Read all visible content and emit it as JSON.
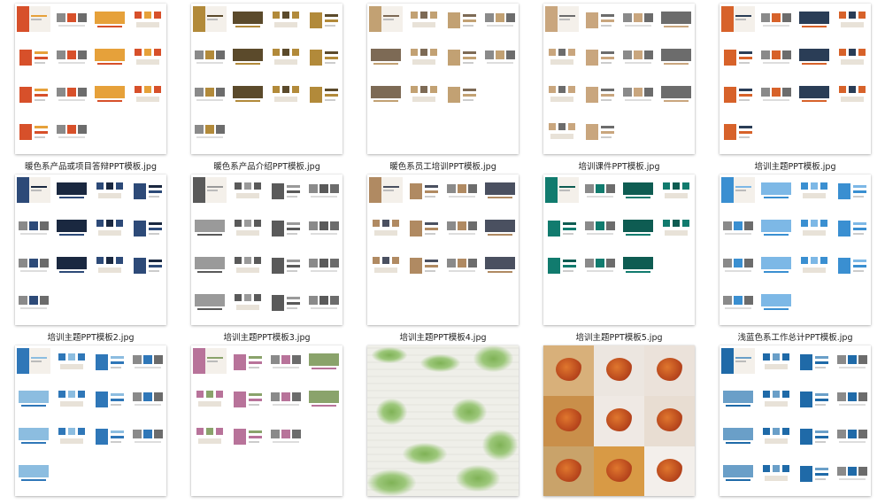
{
  "files": [
    {
      "name": "暖色系产品或项目答辩PPT模板.jpg",
      "theme": "warm",
      "accent": "#d7502a",
      "accent2": "#e6a13a",
      "layout": "slides"
    },
    {
      "name": "暖色系产品介绍PPT模板.jpg",
      "theme": "warm-dark",
      "accent": "#b28a3a",
      "accent2": "#5b4a2b",
      "layout": "slides"
    },
    {
      "name": "暖色系员工培训PPT模板.jpg",
      "theme": "beige",
      "accent": "#c2a173",
      "accent2": "#7d6a55",
      "layout": "slides"
    },
    {
      "name": "培训课件PPT模板.jpg",
      "theme": "beige-gray",
      "accent": "#c9a67e",
      "accent2": "#6c6c6c",
      "layout": "slides"
    },
    {
      "name": "培训主题PPT模板.jpg",
      "theme": "orange-navy",
      "accent": "#d7622a",
      "accent2": "#2a3d56",
      "layout": "slides"
    },
    {
      "name": "培训主题PPT模板2.jpg",
      "theme": "navy",
      "accent": "#2d4a78",
      "accent2": "#1a2840",
      "layout": "slides"
    },
    {
      "name": "培训主题PPT模板3.jpg",
      "theme": "gray",
      "accent": "#5a5a5a",
      "accent2": "#9a9a9a",
      "layout": "slides"
    },
    {
      "name": "培训主题PPT模板4.jpg",
      "theme": "tan",
      "accent": "#b08a62",
      "accent2": "#4a5060",
      "layout": "slides"
    },
    {
      "name": "培训主题PPT模板5.jpg",
      "theme": "teal",
      "accent": "#117b6e",
      "accent2": "#0e5c52",
      "layout": "slides"
    },
    {
      "name": "浅蓝色系工作总计PPT模板.jpg",
      "theme": "lightblue",
      "accent": "#3a8fd1",
      "accent2": "#7db8e6",
      "layout": "slides"
    },
    {
      "name": "",
      "theme": "blue2",
      "accent": "#2f77b8",
      "accent2": "#8cbde0",
      "layout": "slides"
    },
    {
      "name": "",
      "theme": "pink",
      "accent": "#b8739a",
      "accent2": "#8aa36b",
      "layout": "slides"
    },
    {
      "name": "",
      "theme": "leaves",
      "accent": "#6ea34a",
      "accent2": "#dcdcd4",
      "layout": "leaves"
    },
    {
      "name": "",
      "theme": "autumn",
      "accent": "#c8622a",
      "accent2": "#e6b24a",
      "layout": "autumn"
    },
    {
      "name": "",
      "theme": "blue3",
      "accent": "#1f6aa8",
      "accent2": "#6a9fc8",
      "layout": "slides"
    }
  ]
}
